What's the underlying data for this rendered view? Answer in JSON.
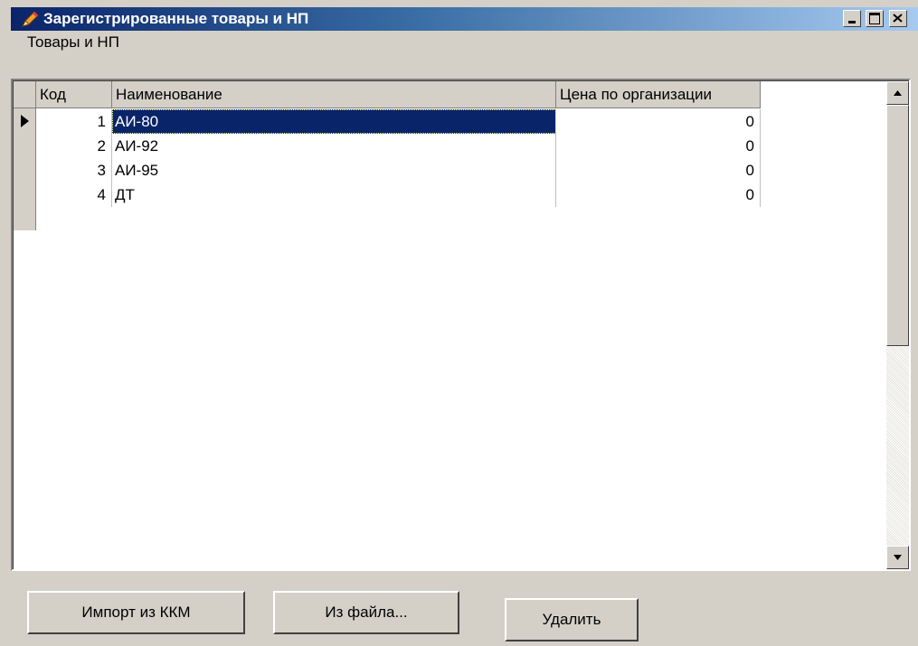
{
  "window": {
    "title": "Зарегистрированные товары и НП",
    "minimize_label": "_",
    "maximize_label": "□",
    "close_label": "×"
  },
  "menu": {
    "items": [
      {
        "label": "Товары и НП"
      }
    ]
  },
  "grid": {
    "columns": [
      {
        "label": "Код"
      },
      {
        "label": "Наименование"
      },
      {
        "label": "Цена по организации"
      }
    ],
    "rows": [
      {
        "code": "1",
        "name": "АИ-80",
        "price": "0",
        "selected": true
      },
      {
        "code": "2",
        "name": "АИ-92",
        "price": "0",
        "selected": false
      },
      {
        "code": "3",
        "name": "АИ-95",
        "price": "0",
        "selected": false
      },
      {
        "code": "4",
        "name": "ДТ",
        "price": "0",
        "selected": false
      }
    ]
  },
  "buttons": {
    "import_label": "Импорт из ККМ",
    "from_file_label": "Из файла...",
    "delete_label": "Удалить"
  },
  "colors": {
    "title_bar": "#0a246a",
    "selection": "#0a246a",
    "face": "#d4d0c8"
  },
  "icons": {
    "app": "pencil-icon",
    "minimize": "minimize-icon",
    "maximize": "maximize-icon",
    "close": "close-icon",
    "row_indicator": "row-pointer-icon",
    "scroll_up": "arrow-up-icon",
    "scroll_down": "arrow-down-icon"
  }
}
